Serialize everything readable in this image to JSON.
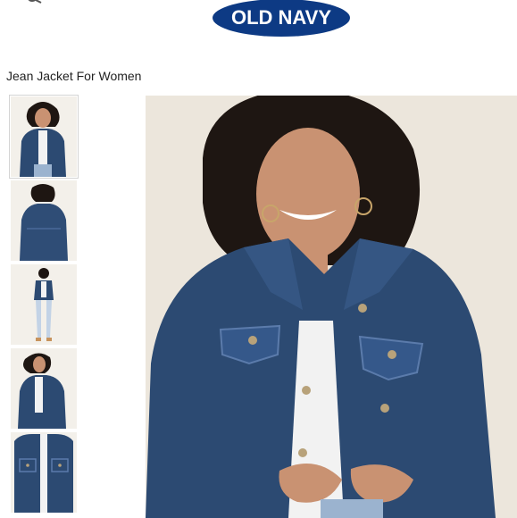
{
  "header": {
    "logo_text": "OLD NAVY",
    "logo_color": "#0d3a84",
    "menu_icon": "search-icon"
  },
  "product": {
    "title": "Jean Jacket For Women"
  },
  "gallery": {
    "thumbnails": [
      {
        "view": "front-closeup",
        "selected": true
      },
      {
        "view": "back",
        "selected": false
      },
      {
        "view": "full-body",
        "selected": false
      },
      {
        "view": "side-sleeve",
        "selected": false
      },
      {
        "view": "detail-closeup",
        "selected": false
      }
    ],
    "main_view": "front-closeup"
  },
  "colors": {
    "denim": "#2c4a72",
    "denim_light": "#5b7bab",
    "backdrop": "#ece6dc",
    "shirt": "#f2f2f2",
    "hair": "#1e1612",
    "skin": "#c99272"
  }
}
